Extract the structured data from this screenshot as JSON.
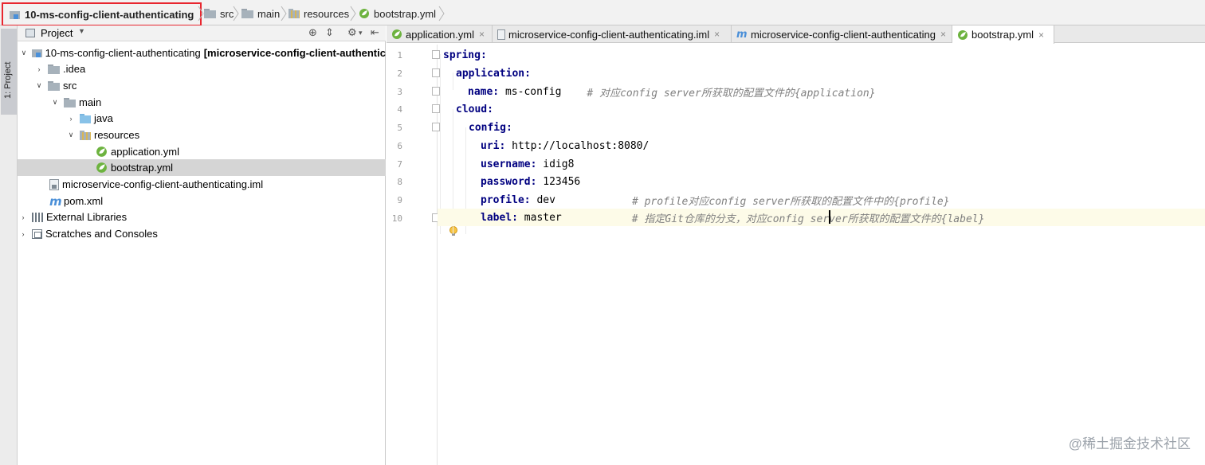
{
  "breadcrumbs": {
    "root": "10-ms-config-client-authenticating",
    "items": [
      "src",
      "main",
      "resources",
      "bootstrap.yml"
    ]
  },
  "tool_window": {
    "label": "1: Project"
  },
  "project_panel": {
    "title": "Project",
    "tree": [
      {
        "label": "10-ms-config-client-authenticating",
        "suffix": "[microservice-config-client-authentic",
        "depth": 0,
        "expanded": true,
        "icon": "module-icon"
      },
      {
        "label": ".idea",
        "depth": 1,
        "expanded": false,
        "icon": "folder-icon"
      },
      {
        "label": "src",
        "depth": 1,
        "expanded": true,
        "icon": "folder-icon"
      },
      {
        "label": "main",
        "depth": 2,
        "expanded": true,
        "icon": "folder-icon"
      },
      {
        "label": "java",
        "depth": 3,
        "expanded": false,
        "icon": "source-folder-icon"
      },
      {
        "label": "resources",
        "depth": 3,
        "expanded": true,
        "icon": "resources-folder-icon"
      },
      {
        "label": "application.yml",
        "depth": 4,
        "icon": "spring-yml-icon"
      },
      {
        "label": "bootstrap.yml",
        "depth": 4,
        "icon": "spring-yml-icon",
        "selected": true
      },
      {
        "label": "microservice-config-client-authenticating.iml",
        "depth": 1,
        "icon": "iml-file-icon"
      },
      {
        "label": "pom.xml",
        "depth": 1,
        "icon": "maven-icon"
      },
      {
        "label": "External Libraries",
        "depth": 0,
        "expanded": false,
        "icon": "libraries-icon"
      },
      {
        "label": "Scratches and Consoles",
        "depth": 0,
        "expanded": false,
        "icon": "scratches-icon"
      }
    ]
  },
  "editor": {
    "tabs": [
      {
        "label": "application.yml",
        "icon": "spring-yml-icon",
        "close": "×"
      },
      {
        "label": "microservice-config-client-authenticating.iml",
        "icon": "iml-file-icon",
        "close": "×"
      },
      {
        "label": "microservice-config-client-authenticating",
        "icon": "maven-icon",
        "close": "×"
      },
      {
        "label": "bootstrap.yml",
        "icon": "spring-yml-icon",
        "close": "×",
        "active": true
      }
    ],
    "current_line": 10,
    "lines": [
      {
        "no": "1",
        "key": "spring:",
        "value": "",
        "comment": ""
      },
      {
        "no": "2",
        "key": "application:",
        "value": "",
        "comment": ""
      },
      {
        "no": "3",
        "key": "name:",
        "value": " ms-config",
        "comment": "# 对应config server所获取的配置文件的{application}"
      },
      {
        "no": "4",
        "key": "cloud:",
        "value": "",
        "comment": ""
      },
      {
        "no": "5",
        "key": "config:",
        "value": "",
        "comment": ""
      },
      {
        "no": "6",
        "key": "uri:",
        "value": " http://localhost:8080/",
        "comment": ""
      },
      {
        "no": "7",
        "key": "username:",
        "value": " idig8",
        "comment": ""
      },
      {
        "no": "8",
        "key": "password:",
        "value": " 123456",
        "comment": ""
      },
      {
        "no": "9",
        "key": "profile:",
        "value": " dev",
        "comment": "# profile对应config server所获取的配置文件中的{profile}"
      },
      {
        "no": "10",
        "key": "label:",
        "value": " master",
        "comment": "# 指定Git仓库的分支，对应config server所获取的配置文件的{label}"
      }
    ]
  },
  "watermark": "@稀土掘金技术社区",
  "colors": {
    "yaml_key": "#000080",
    "comment": "#808080",
    "highlight_border": "#e8262f",
    "selection": "#d5d5d5",
    "current_line": "#fdfbe8"
  }
}
